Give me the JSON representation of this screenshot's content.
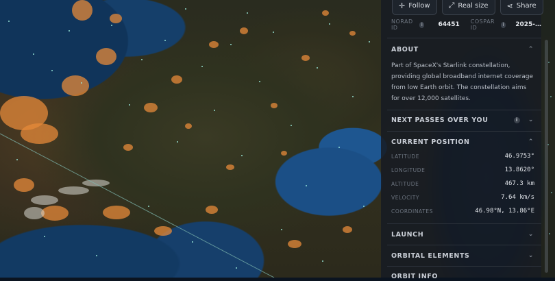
{
  "toolbar": {
    "follow_label": "Follow",
    "real_size_label": "Real size",
    "share_label": "Share",
    "follow_icon": "crosshair-icon",
    "real_size_icon": "expand-icon",
    "share_icon": "share-icon"
  },
  "ids": {
    "norad_label": "NORAD ID",
    "norad_value": "64451",
    "cospar_label": "COSPAR ID",
    "cospar_value": "2025-…"
  },
  "about": {
    "title": "ABOUT",
    "text": "Part of SpaceX's Starlink constellation, providing global broadband internet coverage from low Earth orbit. The constellation aims for over 12,000 satellites."
  },
  "next_passes": {
    "title": "NEXT PASSES OVER YOU"
  },
  "current_position": {
    "title": "CURRENT POSITION",
    "rows": [
      {
        "label": "LATITUDE",
        "value": "46.9753°"
      },
      {
        "label": "LONGITUDE",
        "value": "13.8620°"
      },
      {
        "label": "ALTITUDE",
        "value": "467.3 km"
      },
      {
        "label": "VELOCITY",
        "value": "7.64 km/s"
      },
      {
        "label": "COORDINATES",
        "value": "46.98°N, 13.86°E"
      }
    ]
  },
  "sections": {
    "launch": "LAUNCH",
    "orbital_elements": "ORBITAL ELEMENTS",
    "orbit_info": "ORBIT INFO"
  },
  "colors": {
    "panel_bg": "#161b23",
    "city_lights": "#e58a3a",
    "satellite_dot": "#9ef0e0",
    "ground_track": "#7fb9b0"
  }
}
